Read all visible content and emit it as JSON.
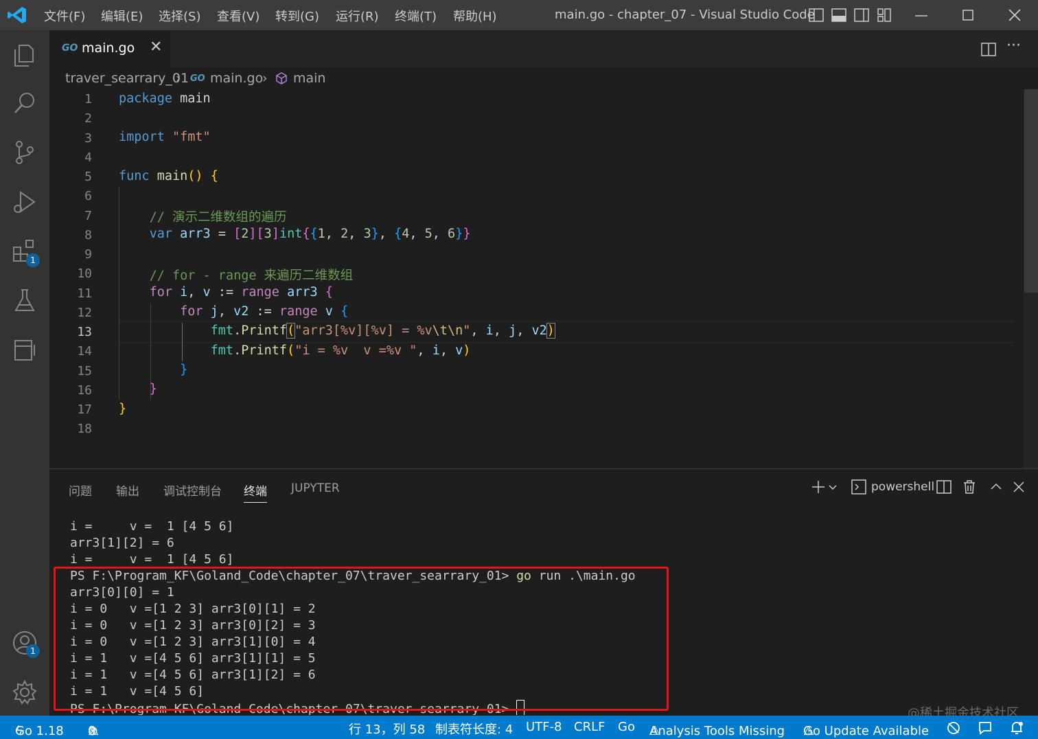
{
  "menu": [
    "文件(F)",
    "编辑(E)",
    "选择(S)",
    "查看(V)",
    "转到(G)",
    "运行(R)",
    "终端(T)",
    "帮助(H)"
  ],
  "window_title": "main.go - chapter_07 - Visual Studio Code",
  "activity_badges": {
    "extensions": "1",
    "accounts": "1"
  },
  "tab": {
    "icon_text": "GO",
    "name": "main.go"
  },
  "breadcrumb": {
    "folder": "traver_searrary_01",
    "file": "main.go",
    "symbol": "main"
  },
  "editor": {
    "line_numbers": [
      "1",
      "2",
      "3",
      "4",
      "5",
      "6",
      "7",
      "8",
      "9",
      "10",
      "11",
      "12",
      "13",
      "14",
      "15",
      "16",
      "17",
      "18"
    ],
    "lines": {
      "l1_kw": "package",
      "l1_rest": " main",
      "l3_kw": "import",
      "l3_str": "\"fmt\"",
      "l5_kw": "func",
      "l5_fn": "main",
      "l7_cm": "// 演示二维数组的遍历",
      "l8_kw": "var",
      "l8_var": "arr3",
      "l8_ty": "int",
      "l10_cm": "// for - range 来遍历二维数组",
      "l11_kw": "for",
      "l11_range": "range",
      "l12_kw": "for",
      "l12_range": "range",
      "l13_pkg": "fmt",
      "l13_fn": "Printf",
      "l13_str1": "\"arr3[%v][%v] = %v",
      "l13_esc": "\\t\\n",
      "l13_str2": "\"",
      "l14_pkg": "fmt",
      "l14_fn": "Printf",
      "l14_str": "\"i = %v  v =%v \""
    }
  },
  "panel": {
    "tabs": [
      "问题",
      "输出",
      "调试控制台",
      "终端",
      "JUPYTER"
    ],
    "shell": "powershell",
    "terminal_lines": [
      "i =     v =  1 [4 5 6]",
      "arr3[1][2] = 6",
      "i =     v =  1 [4 5 6]",
      "PS F:\\Program_KF\\Goland_Code\\chapter_07\\traver_searrary_01> ",
      "arr3[0][0] = 1",
      "i = 0   v =[1 2 3] arr3[0][1] = 2",
      "i = 0   v =[1 2 3] arr3[0][2] = 3",
      "i = 0   v =[1 2 3] arr3[1][0] = 4",
      "i = 1   v =[4 5 6] arr3[1][1] = 5",
      "i = 1   v =[4 5 6] arr3[1][2] = 6",
      "i = 1   v =[4 5 6]",
      "PS F:\\Program_KF\\Goland_Code\\chapter_07\\traver_searrary_01> "
    ],
    "cmd_go": "go",
    "cmd_rest": " run .\\main.go"
  },
  "status": {
    "go_version": "Go 1.18",
    "errors": "0",
    "warnings": "0",
    "position": "行 13，列 58",
    "indent": "制表符长度: 4",
    "encoding": "UTF-8",
    "eol": "CRLF",
    "language": "Go",
    "analysis": "Analysis Tools Missing",
    "update": "Go Update Available"
  },
  "watermark": "@稀土掘金技术社区",
  "colors": {
    "statusbar": "#007acc",
    "highlight": "#e5141b",
    "titlebar": "#3c3c3c"
  }
}
